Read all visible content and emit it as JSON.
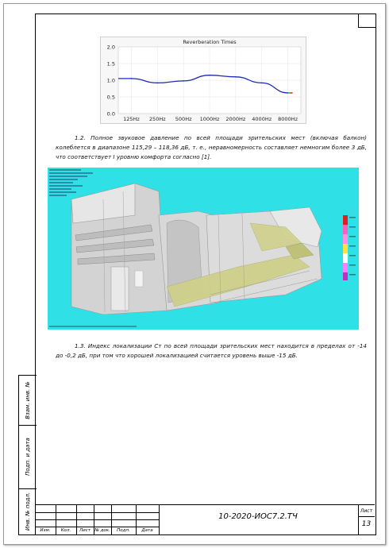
{
  "chart": {
    "title": "Reverberation Times",
    "y_ticks": [
      "2.0",
      "1.5",
      "1.0",
      "0.5",
      "0.0"
    ],
    "x_ticks": [
      "125Hz",
      "250Hz",
      "500Hz",
      "1000Hz",
      "2000Hz",
      "4000Hz",
      "8000Hz"
    ],
    "colors": {
      "line": "#1d2bb5",
      "end_green": "#2fb52f",
      "end_red": "#e22b2b"
    }
  },
  "chart_data": {
    "type": "line",
    "title": "Reverberation Times",
    "categories": [
      "125Hz",
      "250Hz",
      "500Hz",
      "1000Hz",
      "2000Hz",
      "4000Hz",
      "8000Hz"
    ],
    "values": [
      1.05,
      0.92,
      0.98,
      1.15,
      1.1,
      0.92,
      0.62
    ],
    "ylim": [
      0,
      2.0
    ],
    "grid": true
  },
  "paragraphs": {
    "p1": "1.2. Полное звуковое давление по всей площади зрительских мест (включая балкон) колеблется в диапазоне 115,29 – 118,36 дБ, т. е., неравномерность составляет немногим более 3 дБ, что соответствует I уровню комфорта согласно [1].",
    "p2": "1.3. Индекс локализации Cт по всей площади зрительских мест находится в пределах от -14 до -0,2 дБ, при том что хорошей локализацией считается уровень выше -15 дБ."
  },
  "side_labels": {
    "inv_zam": "Взам. инв. №",
    "podp_data": "Подп. и дата",
    "inv_podl": "Инв. № подл."
  },
  "title_block": {
    "columns": [
      "Изм.",
      "Кол.",
      "Лист",
      "№ док.",
      "Подп.",
      "Дата"
    ],
    "code": "10-2020-ИОС7.2.ТЧ",
    "sheet_label": "Лист",
    "sheet_number": "13"
  },
  "model_colors": {
    "background": "#2fe0e6",
    "seating": "#cfd08a",
    "structure": "#c9c9c9"
  }
}
